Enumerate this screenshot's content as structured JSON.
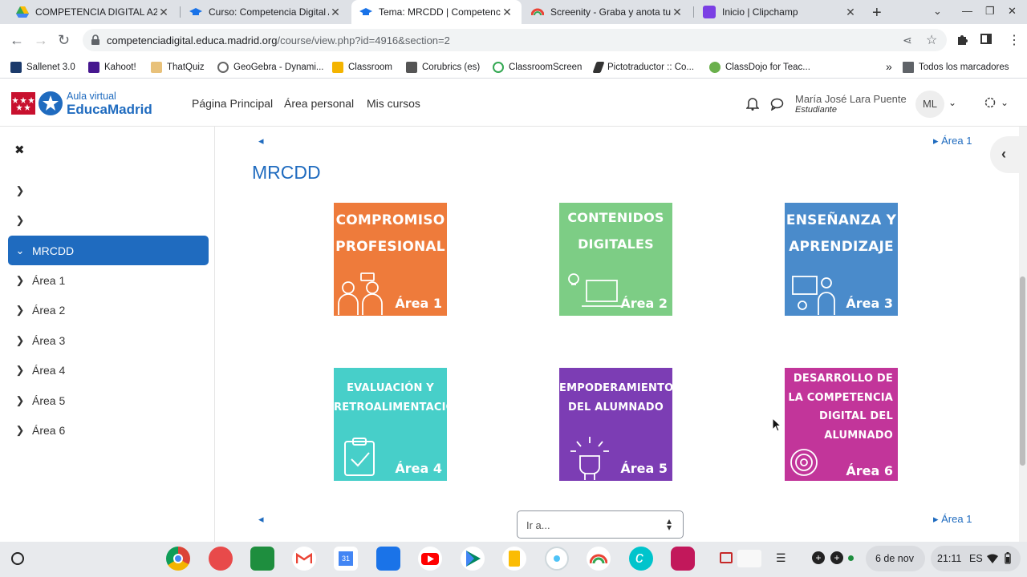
{
  "browser": {
    "tabs": [
      {
        "title": "COMPETENCIA DIGITAL A2 - ",
        "color": "#fbbc04"
      },
      {
        "title": "Curso: Competencia Digital A",
        "color": "#1a73e8"
      },
      {
        "title": "Tema: MRCDD | Competencia",
        "color": "#1a73e8"
      },
      {
        "title": "Screenity - Graba y anota tu p",
        "color": "#ea4335"
      },
      {
        "title": "Inicio | Clipchamp",
        "color": "#7b3fe4"
      }
    ],
    "new_tab": "+",
    "close": "✕",
    "url_host": "competenciadigital.educa.madrid.org",
    "url_path": "/course/view.php?id=4916&section=2",
    "bookmarks": [
      {
        "label": "Sallenet 3.0",
        "color": "#1b3a6b"
      },
      {
        "label": "Kahoot!",
        "color": "#46178f"
      },
      {
        "label": "ThatQuiz",
        "color": "#e8c17a"
      },
      {
        "label": "GeoGebra - Dynami...",
        "color": "#666666"
      },
      {
        "label": "Classroom",
        "color": "#f4b400"
      },
      {
        "label": "Corubrics (es)",
        "color": "#555555"
      },
      {
        "label": "ClassroomScreen",
        "color": "#34a853"
      },
      {
        "label": "Pictotraductor :: Co...",
        "color": "#333333"
      },
      {
        "label": "ClassDojo for Teac...",
        "color": "#6ab04c"
      }
    ],
    "more_bookmarks": "»",
    "all_bookmarks": "Todos los marcadores"
  },
  "site": {
    "logo_line1": "Aula virtual",
    "logo_line2": "EducaMadrid",
    "nav": [
      "Página Principal",
      "Área personal",
      "Mis cursos"
    ],
    "user_name": "María José Lara Puente",
    "user_role": "Estudiante",
    "user_initials": "ML"
  },
  "sidebar": {
    "close": "✖",
    "items": [
      {
        "label": ""
      },
      {
        "label": ""
      },
      {
        "label": "MRCDD",
        "active": true
      },
      {
        "label": "Área 1"
      },
      {
        "label": "Área 2"
      },
      {
        "label": "Área 3"
      },
      {
        "label": "Área 4"
      },
      {
        "label": "Área 5"
      },
      {
        "label": "Área 6"
      }
    ]
  },
  "main": {
    "prev": "◂",
    "next": "▸ Área 1",
    "title": "MRCDD",
    "goto_placeholder": "Ir a...",
    "tiles": [
      {
        "title": "COMPROMISO PROFESIONAL",
        "area": "Área 1",
        "color": "#ee7b3b"
      },
      {
        "title": "CONTENIDOS DIGITALES",
        "area": "Área 2",
        "color": "#7dcd85"
      },
      {
        "title": "ENSEÑANZA Y APRENDIZAJE",
        "area": "Área 3",
        "color": "#4a8bcb"
      },
      {
        "title": "EVALUACIÓN Y RETROALIMENTACIÓN",
        "area": "Área 4",
        "color": "#47cfc9"
      },
      {
        "title": "EMPODERAMIENTO DEL ALUMNADO",
        "area": "Área 5",
        "color": "#7c3db4"
      },
      {
        "title": "DESARROLLO DE LA COMPETENCIA DIGITAL DEL ALUMNADO",
        "area": "Área 6",
        "color": "#c2359a"
      }
    ]
  },
  "taskbar": {
    "apps": [
      {
        "name": "chrome",
        "color": "#db4437"
      },
      {
        "name": "paint",
        "color": "#e84a4a"
      },
      {
        "name": "classroom",
        "color": "#1e8e3e"
      },
      {
        "name": "gmail",
        "color": "#ea4335"
      },
      {
        "name": "calendar",
        "color": "#4285f4"
      },
      {
        "name": "files",
        "color": "#1a73e8"
      },
      {
        "name": "youtube",
        "color": "#ff0000"
      },
      {
        "name": "play-store",
        "color": "#01875f"
      },
      {
        "name": "keep",
        "color": "#fbbc04"
      },
      {
        "name": "screenity",
        "color": "#e0e0e0"
      },
      {
        "name": "rainbow",
        "color": "#f28b82"
      },
      {
        "name": "canva",
        "color": "#00c4cc"
      },
      {
        "name": "clipchamp",
        "color": "#c2185b"
      }
    ],
    "date": "6 de nov",
    "time": "21:11",
    "lang": "ES"
  }
}
